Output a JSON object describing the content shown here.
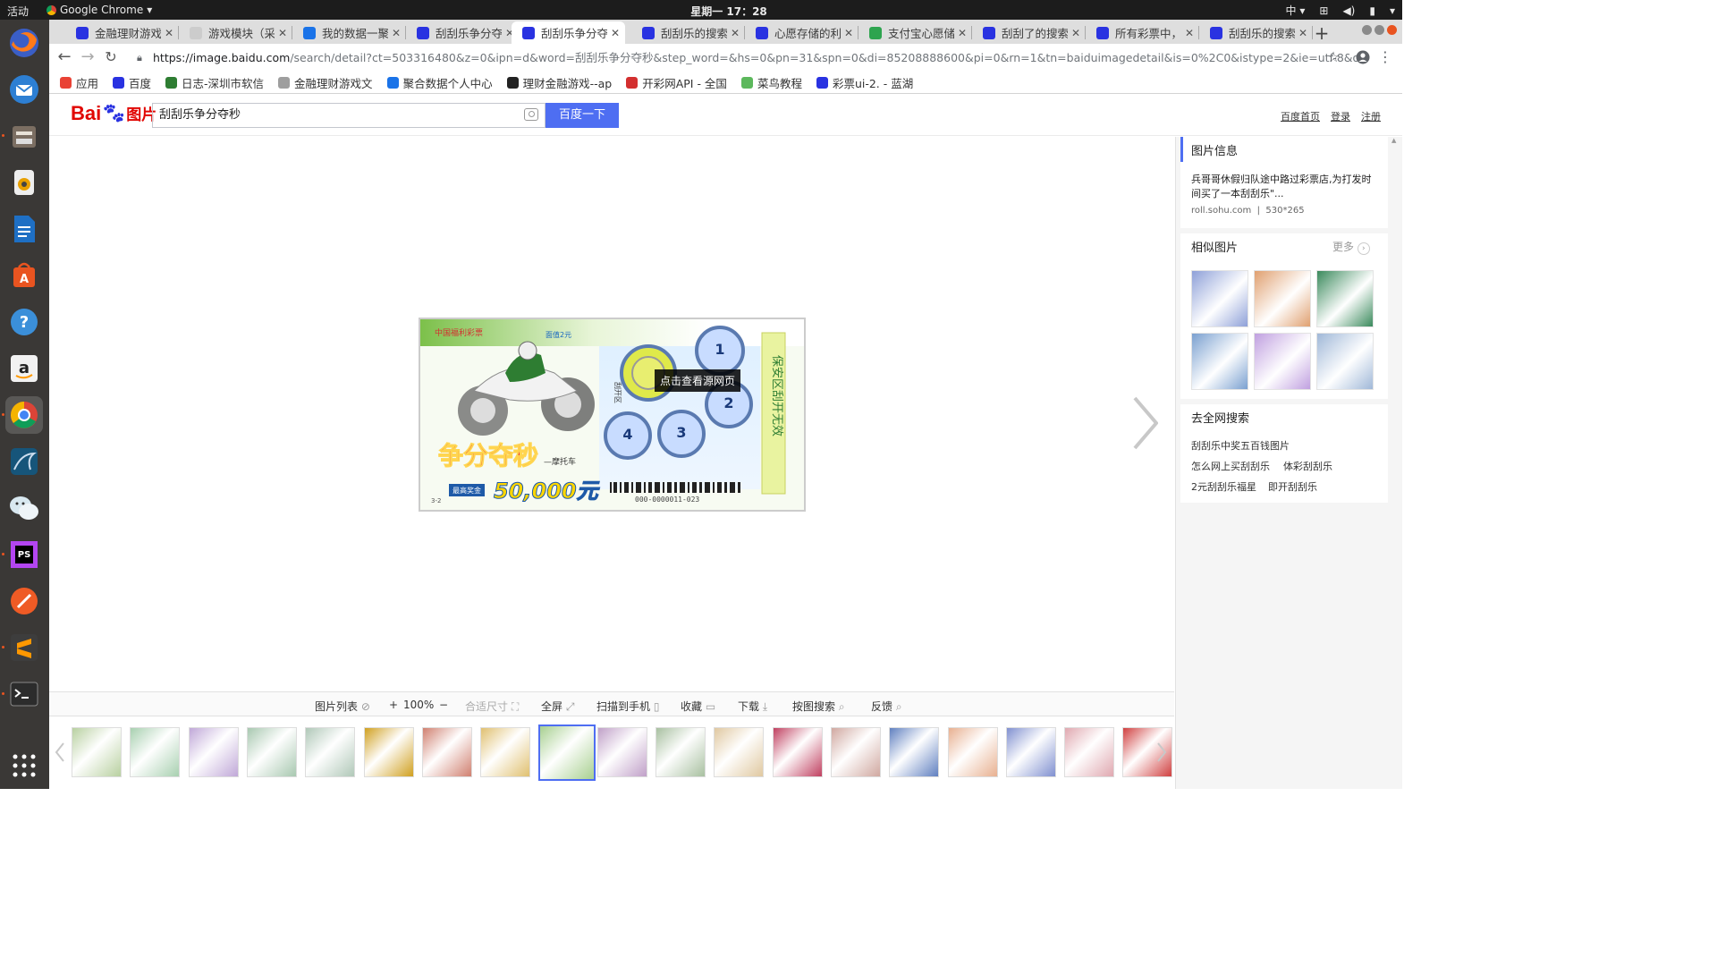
{
  "os": {
    "activities": "活动",
    "app_name": "Google Chrome",
    "clock": "星期一 17：28",
    "input_method": "中"
  },
  "tabs": [
    {
      "title": "金融理财游戏",
      "favicon_color": "#2932e1"
    },
    {
      "title": "游戏模块（采",
      "favicon_color": "#cccccc"
    },
    {
      "title": "我的数据一聚",
      "favicon_color": "#1a73e8"
    },
    {
      "title": "刮刮乐争分夺",
      "favicon_color": "#2932e1"
    },
    {
      "title": "刮刮乐争分夺",
      "favicon_color": "#2932e1"
    },
    {
      "title": "刮刮乐的搜索",
      "favicon_color": "#2932e1"
    },
    {
      "title": "心愿存储的利",
      "favicon_color": "#2932e1"
    },
    {
      "title": "支付宝心愿储",
      "favicon_color": "#2ea44f"
    },
    {
      "title": "刮刮了的搜索",
      "favicon_color": "#2932e1"
    },
    {
      "title": "所有彩票中，",
      "favicon_color": "#2932e1"
    },
    {
      "title": "刮刮乐的搜索",
      "favicon_color": "#2932e1"
    }
  ],
  "active_tab_index": 4,
  "address": {
    "host": "https://image.baidu.com",
    "path": "/search/detail?ct=503316480&z=0&ipn=d&word=刮刮乐争分夺秒&step_word=&hs=0&pn=31&spn=0&di=85208888600&pi=0&rn=1&tn=baiduimagedetail&is=0%2C0&istype=2&ie=utf-8&oe=utf-8&in=&cl=2&lm=-1&st=-1&cs=24..."
  },
  "bookmarks": [
    {
      "label": "应用",
      "color": "#e94235"
    },
    {
      "label": "百度",
      "color": "#2932e1"
    },
    {
      "label": "日志-深圳市软信",
      "color": "#2e7d32"
    },
    {
      "label": "金融理财游戏文",
      "color": "#9e9e9e"
    },
    {
      "label": "聚合数据个人中心",
      "color": "#1a73e8"
    },
    {
      "label": "理财金融游戏--ap",
      "color": "#222222"
    },
    {
      "label": "开彩网API - 全国",
      "color": "#d32f2f"
    },
    {
      "label": "菜鸟教程",
      "color": "#5cb85c"
    },
    {
      "label": "彩票ui-2. - 蓝湖",
      "color": "#2932e1"
    }
  ],
  "baidu": {
    "logo_bai": "Bai",
    "logo_du": "du",
    "logo_pic": "图片",
    "query": "刮刮乐争分夺秒",
    "search_button": "百度一下",
    "links": [
      "百度首页",
      "登录",
      "注册"
    ]
  },
  "viewer": {
    "tooltip": "点击查看源网页",
    "image_text": {
      "brand": "中国福利彩票",
      "title": "争分夺秒",
      "subtitle": "—摩托车",
      "prize": "50,000元",
      "prize_label": "最高奖金",
      "serial": "000-0000011-023",
      "code": "3-2",
      "price": "面值2元",
      "scratch": "保安区刮开无效",
      "zone": "刮开区",
      "circles": [
        "1",
        "2",
        "3",
        "4"
      ]
    }
  },
  "toolbar": {
    "list": "图片列表",
    "zoom": "100%",
    "fit": "合适尺寸",
    "fullscreen": "全屏",
    "scan": "扫描到手机",
    "favorite": "收藏",
    "download": "下载",
    "search_by_image": "按图搜索",
    "feedback": "反馈"
  },
  "sidebar": {
    "info_title": "图片信息",
    "info_desc": "兵哥哥休假归队途中路过彩票店,为打发时间买了一本刮刮乐\"...",
    "info_source": "roll.sohu.com",
    "info_size": "530*265",
    "similar_title": "相似图片",
    "similar_more": "更多",
    "search_title": "去全网搜索",
    "search_links": [
      "刮刮乐中奖五百钱图片",
      "怎么网上买刮刮乐",
      "体彩刮刮乐",
      "2元刮刮乐福星",
      "即开刮刮乐"
    ]
  },
  "similar_colors": [
    "#8ea0d8",
    "#e0a070",
    "#3a8a5c",
    "#7aa0d0",
    "#c0a0e0",
    "#a0b8d8"
  ],
  "thumb_colors": [
    "#b8d0a0",
    "#a8d0b0",
    "#c0a8d8",
    "#a8c8b0",
    "#b0c8b8",
    "#d0a020",
    "#d08070",
    "#e0c070",
    "#a8d090",
    "#c0a0c8",
    "#a8c0a0",
    "#e0c8a0",
    "#c04060",
    "#d0a8a0",
    "#6080c0",
    "#e8b090",
    "#8090d0",
    "#e0a8b0",
    "#d04040"
  ]
}
